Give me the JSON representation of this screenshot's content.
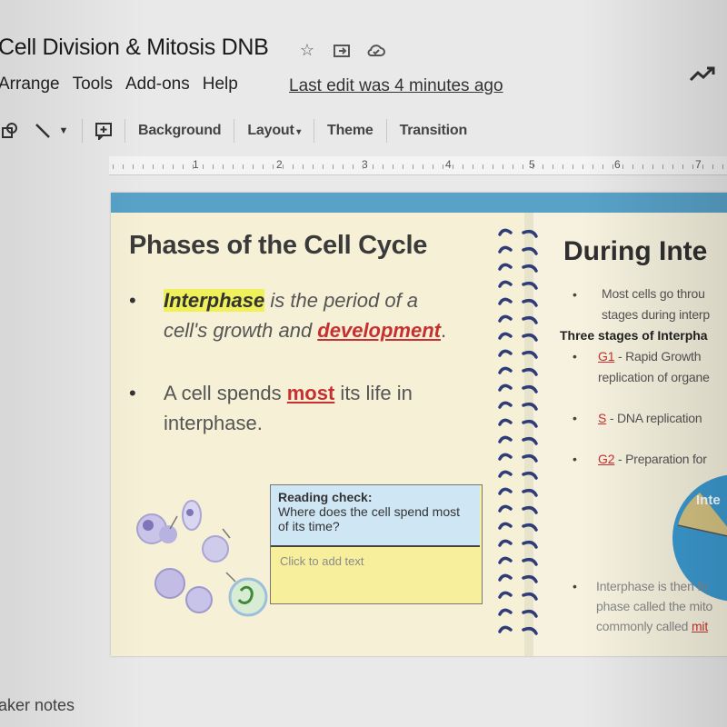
{
  "header": {
    "doc_title": "Cell Division & Mitosis DNB",
    "icons": [
      "star-icon",
      "folder-move-icon",
      "cloud-icon"
    ],
    "menu": [
      "Arrange",
      "Tools",
      "Add-ons",
      "Help"
    ],
    "last_edit": "Last edit was 4 minutes ago"
  },
  "toolbar": {
    "background": "Background",
    "layout": "Layout",
    "theme": "Theme",
    "transition": "Transition"
  },
  "ruler": [
    "1",
    "2",
    "3",
    "4",
    "5",
    "6",
    "7"
  ],
  "slide": {
    "title": "Phases of the Cell Cycle",
    "bullet1": {
      "term": "Interphase",
      "text1": " is the period of a cell's growth and ",
      "link": "development",
      "text2": "."
    },
    "bullet2": {
      "text1": "A cell spends ",
      "emph": "most",
      "text2": " its life in interphase."
    },
    "reading_check": {
      "heading": "Reading check:",
      "question": "Where does the cell spend most of its time?",
      "placeholder": "Click to add text"
    },
    "right_page": {
      "title": "During Inte",
      "line1": "Most cells go throu",
      "line2": "stages during interp",
      "stages_heading": "Three stages of Interpha",
      "g1_label": "G1",
      "g1_text": " - Rapid Growth",
      "g1_line2": "replication of organe",
      "s_label": "S",
      "s_text": " - DNA replication",
      "g2_label": "G2",
      "g2_text": " - Preparation for",
      "pie_label": "Inte",
      "bottom1": "Interphase is then fo",
      "bottom2": "phase called the mito",
      "bottom3": "commonly called ",
      "bottom3_link": "mit"
    }
  },
  "speaker_notes": "aker notes",
  "colors": {
    "slide_header": "#58a2c8",
    "page_bg": "#f5f0d6",
    "highlight": "#f0f05a",
    "link_red": "#c73030",
    "reading_head": "#cfe6f5",
    "reading_body": "#f7ef9c",
    "pie": "#3b9ad0"
  }
}
